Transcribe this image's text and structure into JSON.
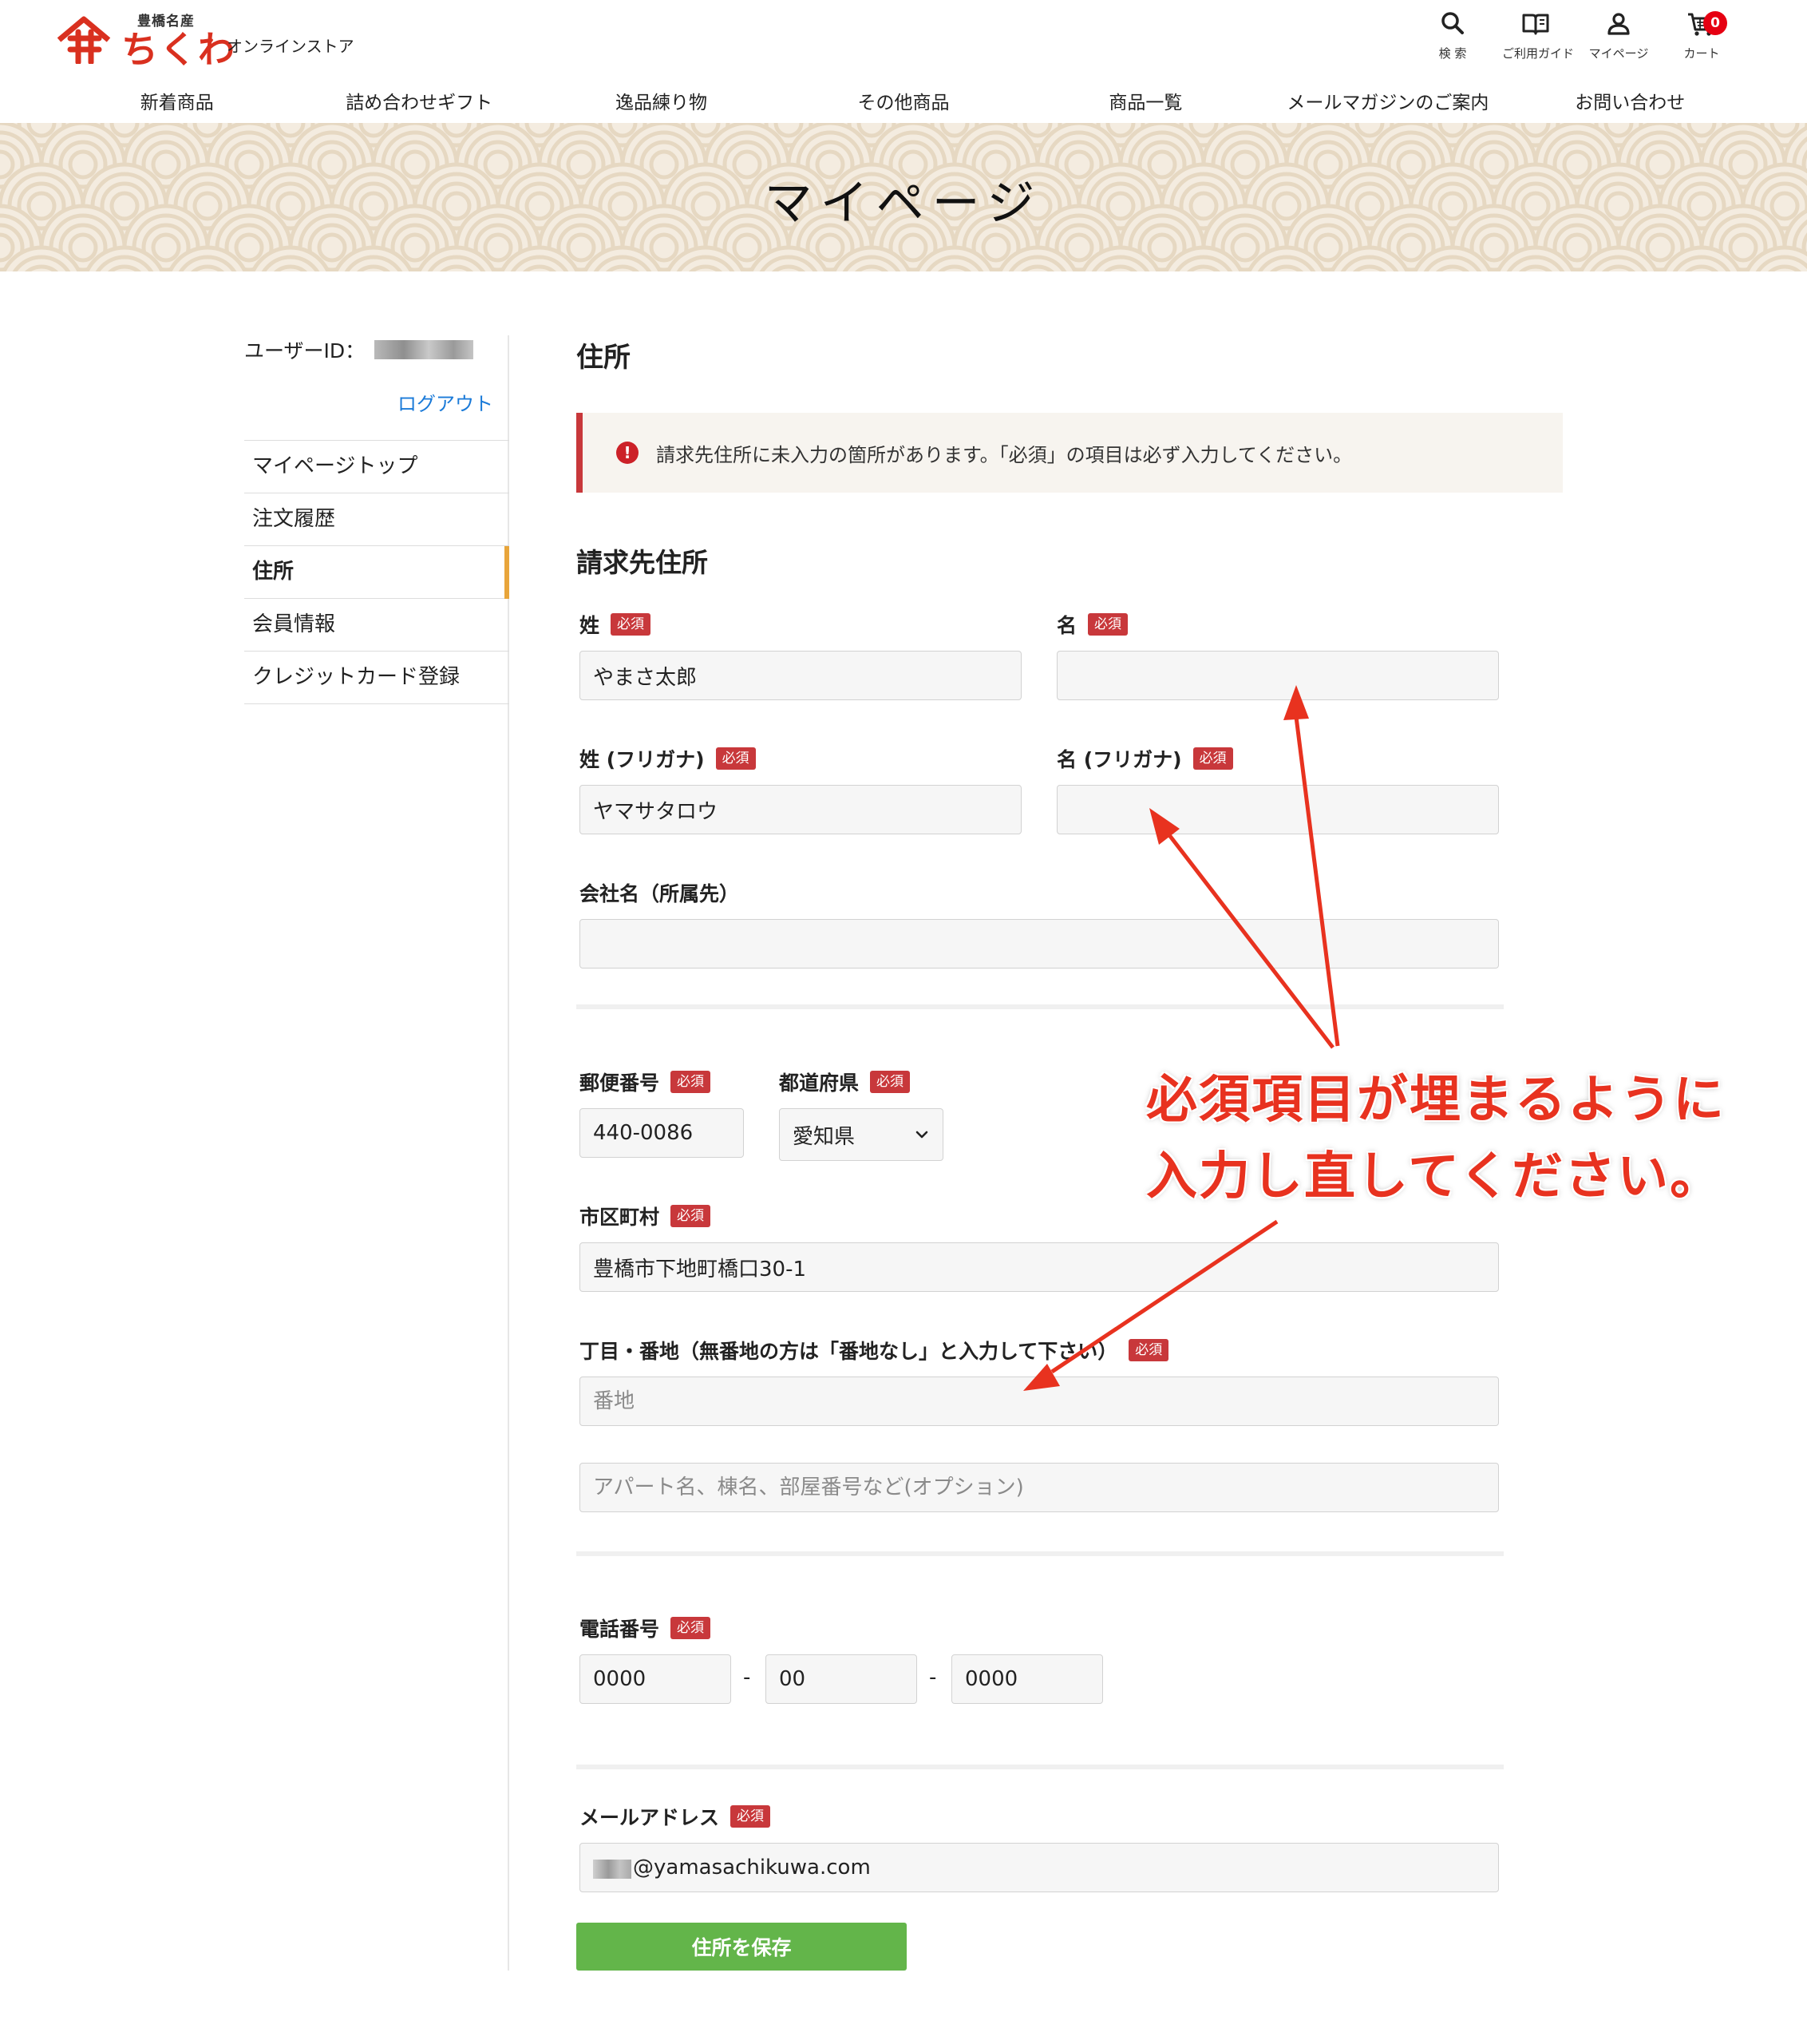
{
  "brand": {
    "sub": "豊橋名産",
    "main": "ちくわ",
    "store": "オンラインストア"
  },
  "header_icons": [
    {
      "name": "search-icon",
      "label": "検 索"
    },
    {
      "name": "book-icon",
      "label": "ご利用ガイド"
    },
    {
      "name": "user-icon",
      "label": "マイページ"
    },
    {
      "name": "cart-icon",
      "label": "カート",
      "badge": "0"
    }
  ],
  "nav": [
    "新着商品",
    "詰め合わせギフト",
    "逸品練り物",
    "その他商品",
    "商品一覧",
    "メールマガジンのご案内",
    "お問い合わせ"
  ],
  "banner": {
    "title": "マイページ"
  },
  "sidebar": {
    "user_label": "ユーザーID：",
    "logout": "ログアウト",
    "items": [
      {
        "label": "マイページトップ",
        "active": false
      },
      {
        "label": "注文履歴",
        "active": false
      },
      {
        "label": "住所",
        "active": true
      },
      {
        "label": "会員情報",
        "active": false
      },
      {
        "label": "クレジットカード登録",
        "active": false
      }
    ]
  },
  "main": {
    "heading": "住所",
    "alert": "請求先住所に未入力の箇所があります。「必須」の項目は必ず入力してください。",
    "section": "請求先住所",
    "required_badge": "必須",
    "fields": {
      "last_name": {
        "label": "姓",
        "value": "やまさ太郎"
      },
      "first_name": {
        "label": "名",
        "value": ""
      },
      "last_kana": {
        "label": "姓 (フリガナ)",
        "value": "ヤマサタロウ"
      },
      "first_kana": {
        "label": "名 (フリガナ)",
        "value": ""
      },
      "company": {
        "label": "会社名（所属先）",
        "value": ""
      },
      "postal": {
        "label": "郵便番号",
        "value": "440-0086"
      },
      "prefecture": {
        "label": "都道府県",
        "value": "愛知県"
      },
      "city": {
        "label": "市区町村",
        "value": "豊橋市下地町橋口30-1"
      },
      "address1": {
        "label": "丁目・番地（無番地の方は「番地なし」と入力して下さい）",
        "value": "",
        "placeholder": "番地"
      },
      "address2": {
        "value": "",
        "placeholder": "アパート名、棟名、部屋番号など(オプション)"
      },
      "phone": {
        "label": "電話番号",
        "part1": "0000",
        "part2": "00",
        "part3": "0000",
        "separator": "-"
      },
      "email": {
        "label": "メールアドレス",
        "value": "@yamasachikuwa.com"
      }
    },
    "save": "住所を保存"
  },
  "annotation": {
    "line1": "必須項目が埋まるように",
    "line2": "入力し直してください。",
    "color": "#e8321f"
  }
}
